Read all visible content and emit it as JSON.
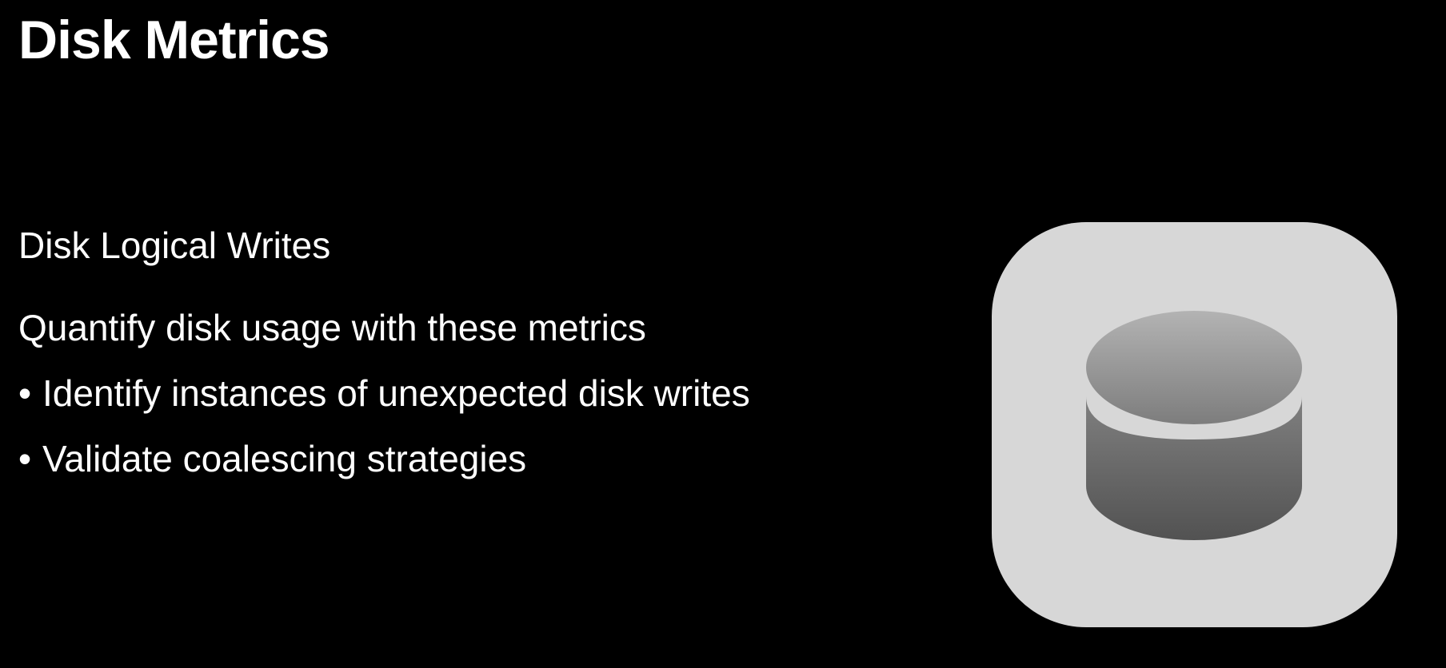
{
  "slide": {
    "title": "Disk Metrics",
    "subtitle": "Disk Logical Writes",
    "intro": "Quantify disk usage with these metrics",
    "bullets": [
      {
        "marker": "•",
        "text": "Identify instances of unexpected disk writes"
      },
      {
        "marker": "•",
        "text": "Validate coalescing strategies"
      }
    ]
  },
  "icon": {
    "name": "disk-storage-icon",
    "tile_color": "#d7d7d7",
    "top_gradient": [
      "#b3b3b3",
      "#7d7d7d"
    ],
    "body_gradient": [
      "#808080",
      "#525252"
    ]
  },
  "colors": {
    "background": "#000000",
    "text": "#ffffff"
  }
}
